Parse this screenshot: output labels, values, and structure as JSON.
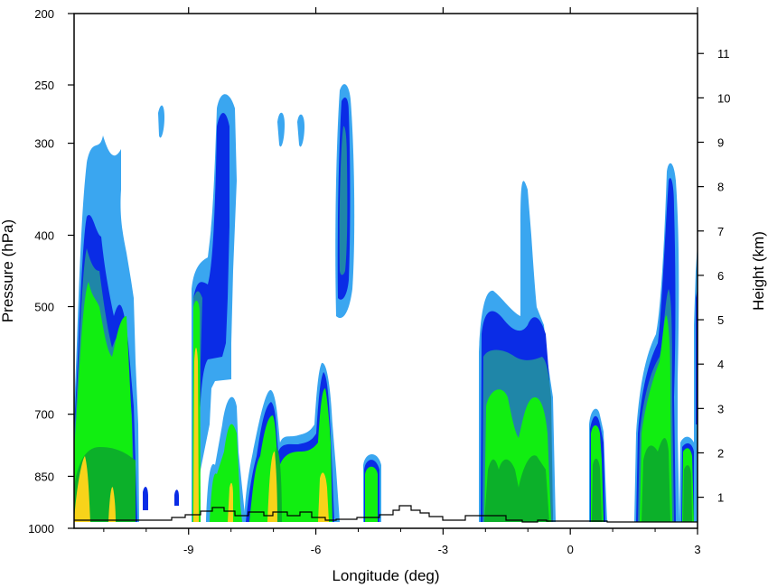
{
  "chart_data": {
    "type": "heatmap",
    "title": "",
    "xlabel": "Longitude (deg)",
    "ylabel_left": "Pressure (hPa)",
    "ylabel_right": "Height (km)",
    "xlim": [
      -11.7,
      3.0
    ],
    "pressure_ylim_hpa": [
      1000,
      200
    ],
    "pressure_scale": "log",
    "height_ylim_km": [
      0.3,
      11.9
    ],
    "x_ticks": [
      {
        "value": -9,
        "label": "-9"
      },
      {
        "value": -6,
        "label": "-6"
      },
      {
        "value": -3,
        "label": "-3"
      },
      {
        "value": 0,
        "label": "0"
      },
      {
        "value": 3,
        "label": "3"
      }
    ],
    "pressure_ticks": [
      {
        "value": 200,
        "label": "200"
      },
      {
        "value": 250,
        "label": "250"
      },
      {
        "value": 300,
        "label": "300"
      },
      {
        "value": 400,
        "label": "400"
      },
      {
        "value": 500,
        "label": "500"
      },
      {
        "value": 700,
        "label": "700"
      },
      {
        "value": 850,
        "label": "850"
      },
      {
        "value": 1000,
        "label": "1000"
      }
    ],
    "height_ticks": [
      {
        "value": 1,
        "label": "1"
      },
      {
        "value": 2,
        "label": "2"
      },
      {
        "value": 3,
        "label": "3"
      },
      {
        "value": 4,
        "label": "4"
      },
      {
        "value": 5,
        "label": "5"
      },
      {
        "value": 6,
        "label": "6"
      },
      {
        "value": 7,
        "label": "7"
      },
      {
        "value": 8,
        "label": "8"
      },
      {
        "value": 9,
        "label": "9"
      },
      {
        "value": 10,
        "label": "10"
      },
      {
        "value": 11,
        "label": "11"
      }
    ],
    "contour_colors": [
      "#3aa6f0",
      "#0a2ce6",
      "#1f86a8",
      "#11ee11",
      "#0cb02a",
      "#f7d31a"
    ],
    "terrain_color": "#000000",
    "cloud_columns": [
      {
        "x": [
          -11.7,
          -10.0
        ],
        "top_hpa": 300,
        "levels": 5
      },
      {
        "x": [
          -8.85,
          -7.8
        ],
        "top_hpa": 265,
        "levels": 6
      },
      {
        "x": [
          -7.15,
          -5.35
        ],
        "top_hpa": 640,
        "levels": 6
      },
      {
        "x": [
          -5.4,
          -5.0
        ],
        "top_hpa": 250,
        "base_hpa": 520,
        "levels": 3
      },
      {
        "x": [
          -4.7,
          -4.4
        ],
        "top_hpa": 800,
        "levels": 5
      },
      {
        "x": [
          -2.0,
          -0.4
        ],
        "top_hpa": 340,
        "levels": 5
      },
      {
        "x": [
          0.4,
          0.9
        ],
        "top_hpa": 725,
        "levels": 5
      },
      {
        "x": [
          1.6,
          2.55
        ],
        "top_hpa": 325,
        "levels": 5
      },
      {
        "x": [
          2.7,
          3.0
        ],
        "top_hpa": 420,
        "levels": 4
      }
    ]
  }
}
